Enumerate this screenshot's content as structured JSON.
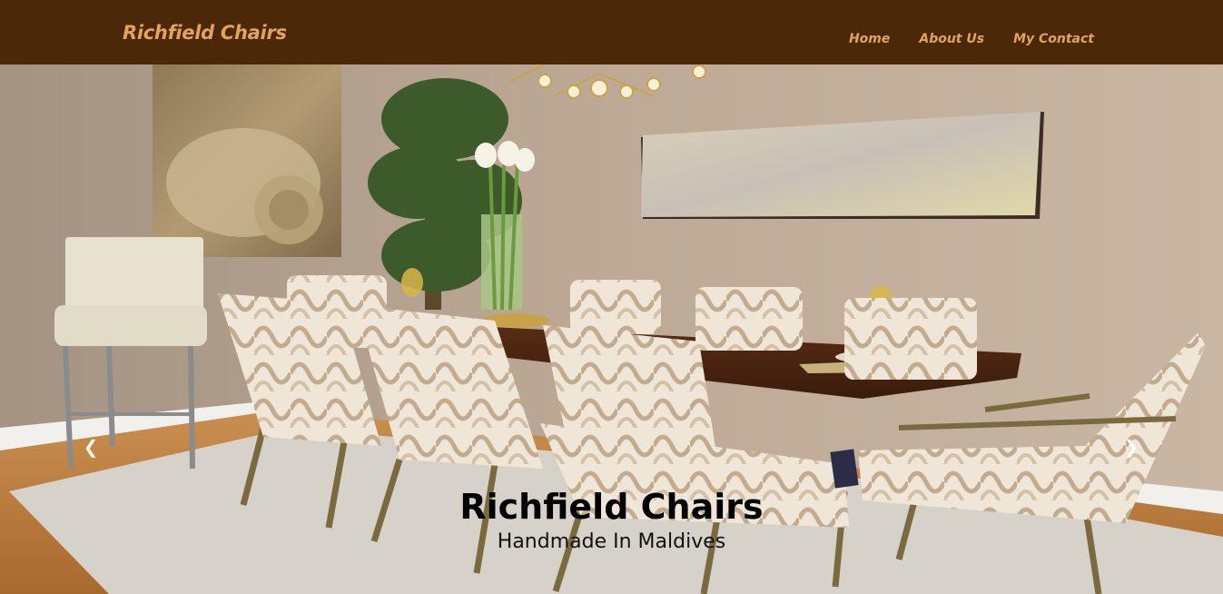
{
  "brand": {
    "name": "Richfield Chairs"
  },
  "nav": {
    "items": [
      "Home",
      "About Us",
      "My Contact"
    ]
  },
  "hero": {
    "title": "Richfield Chairs",
    "subtitle": "Handmade In Maldives",
    "prev_icon": "chevron-left-icon",
    "next_icon": "chevron-right-icon"
  },
  "colors": {
    "navbar_bg": "#4a2808",
    "nav_text": "#e3a35c"
  }
}
